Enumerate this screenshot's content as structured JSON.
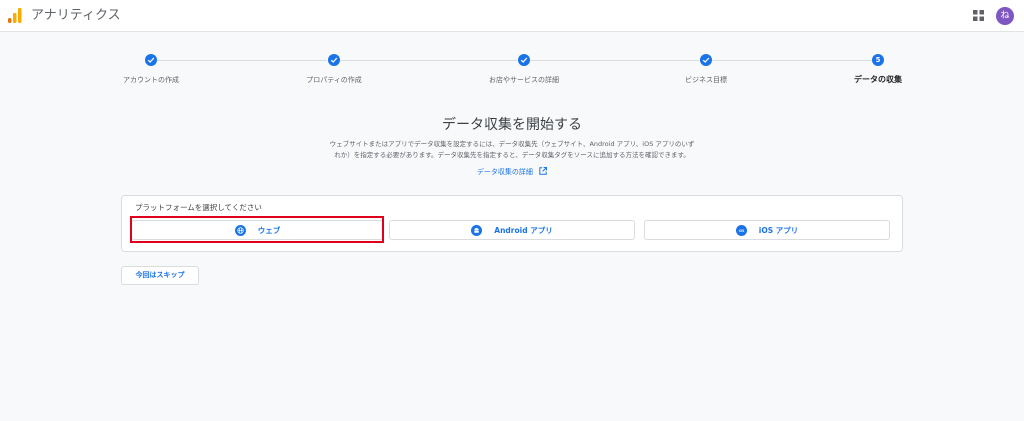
{
  "header": {
    "app_title": "アナリティクス",
    "avatar_initial": "ね",
    "avatar_color": "#7e57c2"
  },
  "stepper": {
    "steps": [
      {
        "label": "アカウントの作成",
        "status": "done"
      },
      {
        "label": "プロパティの作成",
        "status": "done"
      },
      {
        "label": "お店やサービスの詳細",
        "status": "done"
      },
      {
        "label": "ビジネス目標",
        "status": "done"
      },
      {
        "label": "データの収集",
        "status": "current",
        "number": "5"
      }
    ]
  },
  "main": {
    "title": "データ収集を開始する",
    "description_line1": "ウェブサイトまたはアプリでデータ収集を設定するには、データ収集先（ウェブサイト、Android アプリ、iOS アプリのいず",
    "description_line2": "れか）を指定する必要があります。データ収集先を指定すると、データ収集タグをソースに追加する方法を確認できます。",
    "details_link": "データ収集の詳細"
  },
  "platform_card": {
    "title": "プラットフォームを選択してください",
    "options": [
      {
        "label": "ウェブ",
        "icon": "globe-icon"
      },
      {
        "label": "Android アプリ",
        "icon": "android-icon"
      },
      {
        "label": "iOS アプリ",
        "icon": "ios-icon"
      }
    ]
  },
  "skip_button": "今回はスキップ",
  "colors": {
    "accent": "#1a73e8",
    "highlight": "#e0001b",
    "logo_orange": "#f9ab00",
    "logo_dark": "#e37400"
  }
}
